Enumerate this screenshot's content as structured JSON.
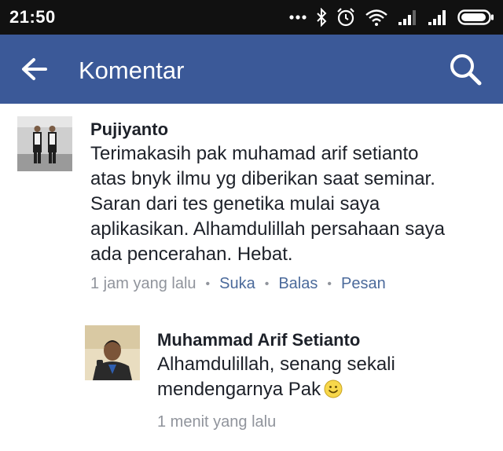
{
  "status_bar": {
    "time": "21:50",
    "icons": [
      "more-dots-icon",
      "bluetooth-icon",
      "alarm-icon",
      "wifi-icon",
      "signal-1-icon",
      "signal-2-icon",
      "battery-icon"
    ]
  },
  "app_bar": {
    "back_icon": "arrow-left-icon",
    "title": "Komentar",
    "search_icon": "search-icon",
    "color": "#3b5998"
  },
  "comments": [
    {
      "author": "Pujiyanto",
      "lines": [
        "Terimakasih pak muhamad arif setianto",
        "atas bnyk ilmu yg diberikan saat seminar.",
        "Saran dari tes genetika mulai saya",
        "aplikasikan. Alhamdulillah persahaan saya",
        "ada pencerahan. Hebat."
      ],
      "time": "1 jam yang lalu",
      "actions": [
        "Suka",
        "Balas",
        "Pesan"
      ]
    },
    {
      "author": "Muhammad Arif Setianto",
      "lines": [
        "Alhamdulillah, senang sekali",
        "mendengarnya Pak"
      ],
      "emoji": "smiley-emoji-icon",
      "time": "1 menit yang lalu"
    }
  ]
}
